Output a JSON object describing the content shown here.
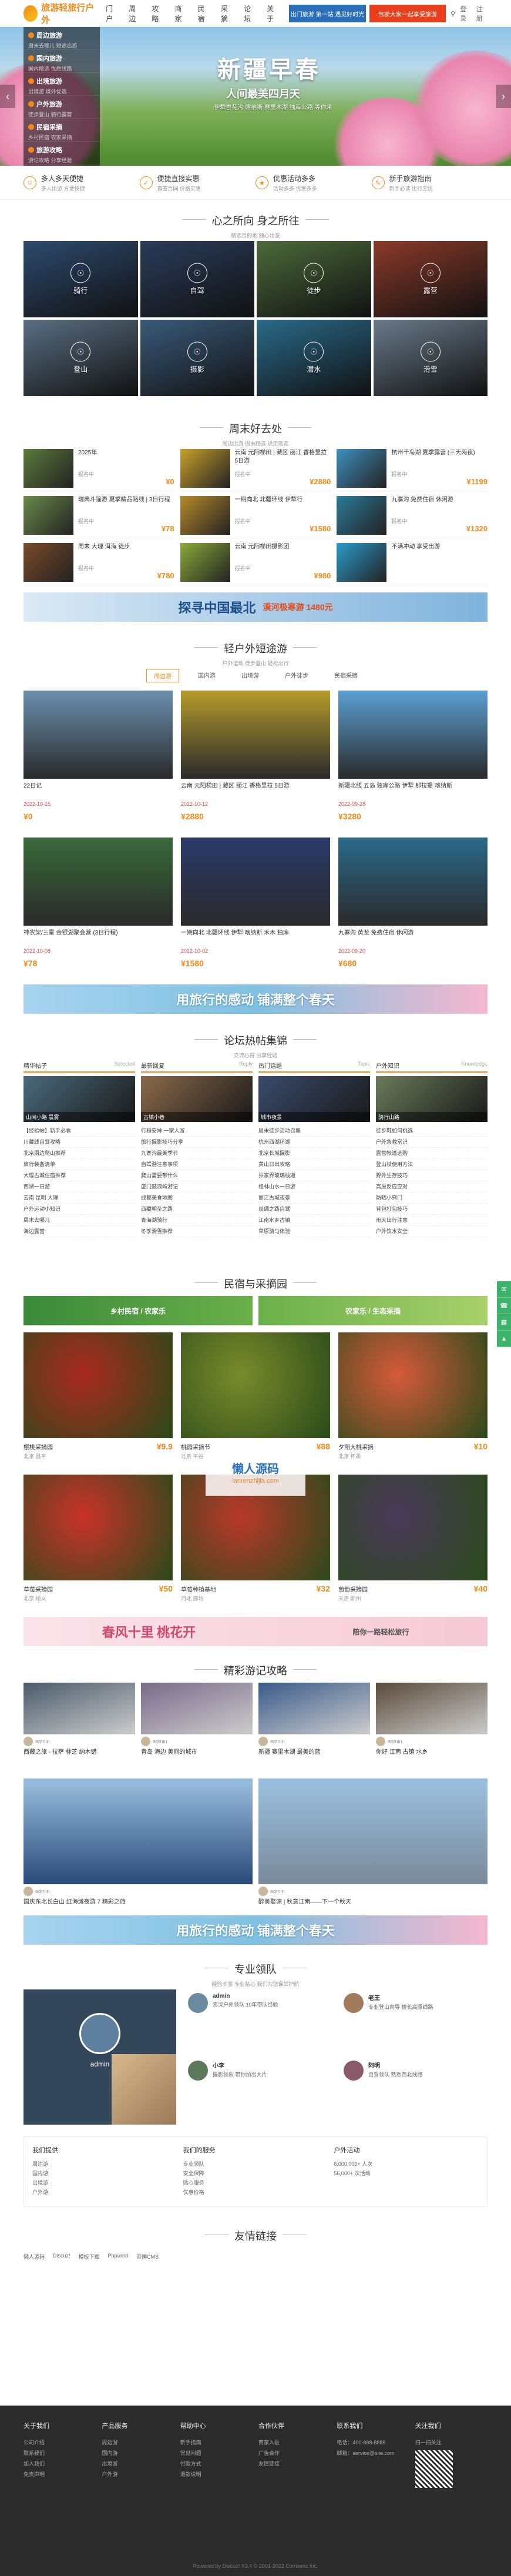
{
  "header": {
    "logo": "旅游轻旅行户外",
    "nav": [
      "门户",
      "周边",
      "攻略",
      "商家",
      "民宿",
      "采摘",
      "论坛",
      "关于"
    ],
    "ad1": "出门旅游 第一站 遇见好时光",
    "ad2": "驾驶大家一起享受旅游",
    "login": "登录",
    "register": "注册"
  },
  "hero": {
    "title": "新疆早春",
    "subtitle": "人间最美四月天",
    "desc": "伊犁杏花沟 喀纳斯 赛里木湖 独库公路 等你来"
  },
  "sidebar": [
    {
      "title": "周边旅游",
      "sub": "周末去哪儿 短途出游"
    },
    {
      "title": "国内旅游",
      "sub": "国内精选 优质线路"
    },
    {
      "title": "出境旅游",
      "sub": "出境游 境外优选"
    },
    {
      "title": "户外旅游",
      "sub": "徒步登山 骑行露营"
    },
    {
      "title": "民宿采摘",
      "sub": "乡村民宿 农家采摘"
    },
    {
      "title": "旅游攻略",
      "sub": "游记攻略 分享经验"
    }
  ],
  "features": [
    {
      "title": "多人多天便捷",
      "desc": "多人出游 方便快捷"
    },
    {
      "title": "便捷直接实惠",
      "desc": "直签合同 价格实惠"
    },
    {
      "title": "优惠活动多多",
      "desc": "活动多多 优惠多多"
    },
    {
      "title": "新手旅游指南",
      "desc": "新手必读 出行无忧"
    }
  ],
  "s1": {
    "title": "心之所向 身之所往",
    "sub": "精选目的地 随心出发"
  },
  "destinations": [
    {
      "name": "骑行",
      "color": "#2d4a6e"
    },
    {
      "name": "自驾",
      "color": "#2a3c5a"
    },
    {
      "name": "徒步",
      "color": "#4c6a3a"
    },
    {
      "name": "露营",
      "color": "#8a3a2a"
    },
    {
      "name": "登山",
      "color": "#5a6e82"
    },
    {
      "name": "摄影",
      "color": "#3a5a7a"
    },
    {
      "name": "潜水",
      "color": "#2a6a8a"
    },
    {
      "name": "滑雪",
      "color": "#6a7a8a"
    }
  ],
  "s2": {
    "title": "周末好去处",
    "sub": "周边出游 周末精选 说走就走"
  },
  "weekend": [
    {
      "title": "2025年",
      "meta": "报名中",
      "price": "¥0",
      "c1": "#5a7a3a"
    },
    {
      "title": "云南 元阳梯田 | 藏区 丽江 香格里拉 5日游",
      "meta": "报名中",
      "price": "¥2880",
      "c1": "#c9a02a"
    },
    {
      "title": "杭州千岛湖 夏季露营 (三天两夜)",
      "meta": "报名中",
      "price": "¥1199",
      "c1": "#3f8fbf"
    },
    {
      "title": "瑞典斗篷游 夏季精品路线 | 3日行程",
      "meta": "报名中",
      "price": "¥78",
      "c1": "#6a8a4a"
    },
    {
      "title": "一期向北 北疆环线 伊犁行",
      "meta": "报名中",
      "price": "¥1580",
      "c1": "#b58a2a"
    },
    {
      "title": "九寨沟 免费住宿 休闲游",
      "meta": "报名中",
      "price": "¥1320",
      "c1": "#2a7a9a"
    },
    {
      "title": "周末 大理 洱海 徒步",
      "meta": "报名中",
      "price": "¥780",
      "c1": "#7a4a2a"
    },
    {
      "title": "云南 元阳梯田摄影团",
      "meta": "报名中",
      "price": "¥980",
      "c1": "#8aaa3a"
    },
    {
      "title": "不满冲动 享受出游",
      "meta": "",
      "price": "",
      "c1": "#2a9ac9"
    }
  ],
  "banner1": {
    "left": "探寻中国最北",
    "right": "漠河极寒游 1480元"
  },
  "s3": {
    "title": "轻户外短途游",
    "sub": "户外运动 徒步登山 轻松出行"
  },
  "tabs": [
    "周边游",
    "国内游",
    "出境游",
    "户外徒步",
    "民宿采摘"
  ],
  "routes": [
    {
      "title": "22日记",
      "date": "2022-10-15",
      "price": "¥0",
      "c": "#6b8fae"
    },
    {
      "title": "云南 元阳梯田 | 藏区 丽江 香格里拉 5日游",
      "date": "2022-10-12",
      "price": "¥2880",
      "c": "#b59c2a"
    },
    {
      "title": "新疆北线 五岛 独库公路 伊犁 那拉提 喀纳斯",
      "date": "2022-09-28",
      "price": "¥3280",
      "c": "#5a9fd4"
    },
    {
      "title": "神农架/三星 金银湖聚会营 (3日行程)",
      "date": "2022-10-08",
      "price": "¥78",
      "c": "#3a6a3a"
    },
    {
      "title": "一期向北 北疆环线 伊犁 喀纳斯 禾木 独库",
      "date": "2022-10-02",
      "price": "¥1580",
      "c": "#2a3a6a"
    },
    {
      "title": "九寨沟 黄龙 免费住宿 休闲游",
      "date": "2022-09-20",
      "price": "¥680",
      "c": "#2a6a8a"
    }
  ],
  "banner2": "用旅行的感动 铺满整个春天",
  "s4": {
    "title": "论坛热帖集锦",
    "sub": "交流心得 分享经验"
  },
  "forum": [
    {
      "head": "精华帖子",
      "en": "Selected",
      "img": "山间小路 晨雾",
      "c": "#4a6a7a",
      "list": [
        "【经验帖】新手必看",
        "川藏线自驾攻略",
        "北京周边爬山推荐",
        "旅行装备清单",
        "大理古城住宿推荐",
        "西湖一日游",
        "云南 昆明 大理",
        "户外运动小知识",
        "周末去哪儿",
        "海边露营"
      ]
    },
    {
      "head": "最新回复",
      "en": "Reply",
      "img": "古镇小巷",
      "c": "#8a6a4a",
      "list": [
        "行程安排 一家人游",
        "旅行摄影技巧分享",
        "九寨沟最美季节",
        "自驾游注意事项",
        "爬山需要带什么",
        "厦门鼓浪屿游记",
        "成都美食地图",
        "西藏朝圣之路",
        "青海湖骑行",
        "冬季滑雪推荐"
      ]
    },
    {
      "head": "热门话题",
      "en": "Topic",
      "img": "城市夜景",
      "c": "#3a4a6a",
      "list": [
        "周末徒步活动召集",
        "杭州西湖环湖",
        "北京长城摄影",
        "黄山日出攻略",
        "张家界玻璃栈道",
        "桂林山水一日游",
        "丽江古城夜景",
        "丝绸之路自驾",
        "江南水乡古镇",
        "草原骑马体验"
      ]
    },
    {
      "head": "户外知识",
      "en": "Knowledge",
      "img": "骑行山路",
      "c": "#6a7a5a",
      "list": [
        "徒步鞋如何挑选",
        "户外急救常识",
        "露营帐篷选购",
        "登山杖使用方法",
        "野外生存技巧",
        "高原反应应对",
        "防晒小窍门",
        "背包打包技巧",
        "雨天出行注意",
        "户外饮水安全"
      ]
    }
  ],
  "watermark": {
    "t": "懒人源码",
    "u": "lanrenzhijia.com"
  },
  "s5": {
    "title": "民宿与采摘园",
    "sub": ""
  },
  "farmTop": [
    "乡村民宿 / 农家乐",
    "农家乐 / 生态采摘"
  ],
  "farms": [
    {
      "title": "樱桃采摘园",
      "meta": "北京 昌平",
      "price": "¥9.9",
      "c": "#a8291f"
    },
    {
      "title": "桃园采摘节",
      "meta": "北京 平谷",
      "price": "¥88",
      "c": "#7a8a2a"
    },
    {
      "title": "夕阳大桃采摘",
      "meta": "北京 怀柔",
      "price": "¥10",
      "c": "#d45a3a"
    },
    {
      "title": "草莓采摘园",
      "meta": "北京 顺义",
      "price": "¥50",
      "c": "#c9322a"
    },
    {
      "title": "草莓种植基地",
      "meta": "河北 廊坊",
      "price": "¥32",
      "c": "#b8382a"
    },
    {
      "title": "葡萄采摘园",
      "meta": "天津 蓟州",
      "price": "¥40",
      "c": "#4a3a5a"
    }
  ],
  "banner3": {
    "left": "春风十里 桃花开",
    "right": "陪你一路轻松旅行"
  },
  "s6": {
    "title": "精彩游记攻略",
    "sub": ""
  },
  "guides": [
    {
      "title": "西藏之旅 - 拉萨 林芝 纳木错",
      "author": "admin",
      "c": "#4a5a6a"
    },
    {
      "title": "青岛 海边 美丽的城市",
      "author": "admin",
      "c": "#7a6a8a"
    },
    {
      "title": "新疆 赛里木湖 最美的蓝",
      "author": "admin",
      "c": "#3a5a8a"
    },
    {
      "title": "你好 江南 古镇 水乡",
      "author": "admin",
      "c": "#5a4a3a"
    }
  ],
  "guideBig": [
    {
      "title": "国庆东北长白山 红海滩夜游 7 精彩之旅",
      "author": "admin",
      "c": "#2a4a7a"
    },
    {
      "title": "醉美婺源 | 秋意江南——下一个秋天",
      "author": "admin",
      "c": "#7a8a9a"
    }
  ],
  "banner4": "用旅行的感动 铺满整个春天",
  "s7": {
    "title": "专业领队",
    "sub": "经验丰富 专业贴心 我们为您保驾护航"
  },
  "leaders": [
    {
      "name": "admin",
      "desc": "资深户外领队 10年带队经验",
      "c": "#6a8aa0"
    },
    {
      "name": "老王",
      "desc": "专业登山向导 擅长高原线路",
      "c": "#a07a5a"
    },
    {
      "name": "小李",
      "desc": "摄影领队 带你拍出大片",
      "c": "#5a7a5a"
    },
    {
      "name": "阿明",
      "desc": "自驾领队 熟悉西北线路",
      "c": "#8a5a6a"
    }
  ],
  "leaderLeft": "admin",
  "services": [
    {
      "title": "我们提供",
      "items": [
        "周边游",
        "国内游",
        "出境游",
        "户外游"
      ]
    },
    {
      "title": "我们的服务",
      "items": [
        "专业领队",
        "安全保障",
        "贴心服务",
        "优惠价格"
      ]
    },
    {
      "title": "户外活动",
      "items": [
        "6,000,000+ 人次",
        "56,000+ 次活动"
      ]
    }
  ],
  "s8": {
    "title": "友情链接",
    "sub": ""
  },
  "links": [
    "懒人源码",
    "Discuz!",
    "模板下载",
    "Phpwind",
    "帝国CMS"
  ],
  "footer": [
    {
      "title": "关于我们",
      "items": [
        "公司介绍",
        "联系我们",
        "加入我们",
        "免责声明"
      ]
    },
    {
      "title": "产品服务",
      "items": [
        "周边游",
        "国内游",
        "出境游",
        "户外游"
      ]
    },
    {
      "title": "帮助中心",
      "items": [
        "新手指南",
        "常见问题",
        "付款方式",
        "退款说明"
      ]
    },
    {
      "title": "合作伙伴",
      "items": [
        "商家入驻",
        "广告合作",
        "友情链接"
      ]
    },
    {
      "title": "联系我们",
      "items": [
        "电话：400-888-8888",
        "邮箱：service@site.com"
      ]
    },
    {
      "title": "关注我们",
      "items": [
        "扫一扫关注"
      ]
    }
  ],
  "copyright": "Powered by Discuz! X3.4 © 2001-2022 Comsenz Inc."
}
